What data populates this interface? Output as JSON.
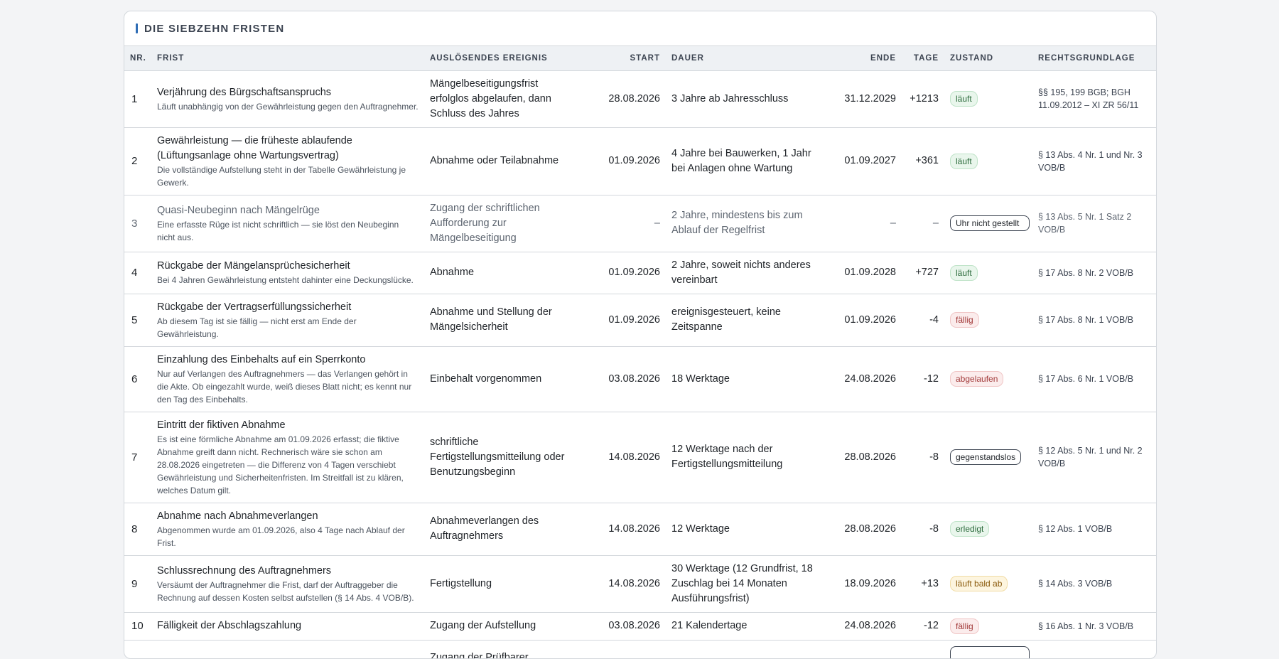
{
  "section": {
    "title": "DIE SIEBZEHN FRISTEN"
  },
  "columns": {
    "nr": "NR.",
    "frist": "FRIST",
    "ereignis": "AUSLÖSENDES EREIGNIS",
    "start": "START",
    "dauer": "DAUER",
    "ende": "ENDE",
    "tage": "TAGE",
    "zustand": "ZUSTAND",
    "rechtsgrundlage": "RECHTSGRUNDLAGE"
  },
  "colors": {
    "green": "#2c6b3c",
    "red": "#a23a3a",
    "yellow": "#8a5a0c",
    "accent": "#2f6db5"
  },
  "rows": [
    {
      "nr": "1",
      "title": "Verjährung des Bürgschaftsanspruchs",
      "sub": "Läuft unabhängig von der Gewährleistung gegen den Auftragnehmer.",
      "ereignis": "Mängelbeseitigungsfrist erfolglos abgelaufen, dann Schluss des Jahres",
      "start": "28.08.2026",
      "dauer": "3 Jahre ab Jahresschluss",
      "ende": "31.12.2029",
      "tage": "+1213",
      "zustand": "läuft",
      "zustand_style": "green",
      "law": "§§ 195, 199 BGB; BGH 11.09.2012 – XI ZR 56/11"
    },
    {
      "nr": "2",
      "title": "Gewährleistung — die früheste ablaufende (Lüftungsanlage ohne Wartungsvertrag)",
      "sub": "Die vollständige Aufstellung steht in der Tabelle Gewährleistung je Gewerk.",
      "ereignis": "Abnahme oder Teilabnahme",
      "start": "01.09.2026",
      "dauer": "4 Jahre bei Bauwerken, 1 Jahr bei Anlagen ohne Wartung",
      "ende": "01.09.2027",
      "tage": "+361",
      "zustand": "läuft",
      "zustand_style": "green",
      "law": "§ 13 Abs. 4 Nr. 1 und Nr. 3 VOB/B"
    },
    {
      "nr": "3",
      "title": "Quasi-Neubeginn nach Mängelrüge",
      "sub": "Eine erfasste Rüge ist nicht schriftlich — sie löst den Neubeginn nicht aus.",
      "ereignis": "Zugang der schriftlichen Aufforderung zur Mängelbeseitigung",
      "start": "–",
      "dauer": "2 Jahre, mindestens bis zum Ablauf der Regelfrist",
      "ende": "–",
      "tage": "–",
      "zustand": "Uhr nicht gestellt",
      "zustand_style": "outline-wrap",
      "law": "§ 13 Abs. 5 Nr. 1 Satz 2 VOB/B",
      "muted": true
    },
    {
      "nr": "4",
      "title": "Rückgabe der Mängelansprüchesicherheit",
      "sub": "Bei 4 Jahren Gewährleistung entsteht dahinter eine Deckungslücke.",
      "ereignis": "Abnahme",
      "start": "01.09.2026",
      "dauer": "2 Jahre, soweit nichts anderes vereinbart",
      "ende": "01.09.2028",
      "tage": "+727",
      "zustand": "läuft",
      "zustand_style": "green",
      "law": "§ 17 Abs. 8 Nr. 2 VOB/B"
    },
    {
      "nr": "5",
      "title": "Rückgabe der Vertragserfüllungssicherheit",
      "sub": "Ab diesem Tag ist sie fällig — nicht erst am Ende der Gewährleistung.",
      "ereignis": "Abnahme und Stellung der Mängelsicherheit",
      "start": "01.09.2026",
      "dauer": "ereignisgesteuert, keine Zeitspanne",
      "ende": "01.09.2026",
      "tage": "-4",
      "zustand": "fällig",
      "zustand_style": "red",
      "law": "§ 17 Abs. 8 Nr. 1 VOB/B"
    },
    {
      "nr": "6",
      "title": "Einzahlung des Einbehalts auf ein Sperrkonto",
      "sub": "Nur auf Verlangen des Auftragnehmers — das Verlangen gehört in die Akte. Ob eingezahlt wurde, weiß dieses Blatt nicht; es kennt nur den Tag des Einbehalts.",
      "ereignis": "Einbehalt vorgenommen",
      "start": "03.08.2026",
      "dauer": "18 Werktage",
      "ende": "24.08.2026",
      "tage": "-12",
      "zustand": "abgelaufen",
      "zustand_style": "red",
      "law": "§ 17 Abs. 6 Nr. 1 VOB/B"
    },
    {
      "nr": "7",
      "title": "Eintritt der fiktiven Abnahme",
      "sub": "Es ist eine förmliche Abnahme am 01.09.2026 erfasst; die fiktive Abnahme greift dann nicht. Rechnerisch wäre sie schon am 28.08.2026 eingetreten — die Differenz von 4 Tagen verschiebt Gewährleistung und Sicherheitenfristen. Im Streitfall ist zu klären, welches Datum gilt.",
      "ereignis": "schriftliche Fertigstellungsmitteilung oder Benutzungsbeginn",
      "start": "14.08.2026",
      "dauer": "12 Werktage nach der Fertigstellungsmitteilung",
      "ende": "28.08.2026",
      "tage": "-8",
      "zustand": "gegenstandslos",
      "zustand_style": "outline",
      "law": "§ 12 Abs. 5 Nr. 1 und Nr. 2 VOB/B"
    },
    {
      "nr": "8",
      "title": "Abnahme nach Abnahmeverlangen",
      "sub": "Abgenommen wurde am 01.09.2026, also 4 Tage nach Ablauf der Frist.",
      "ereignis": "Abnahmeverlangen des Auftragnehmers",
      "start": "14.08.2026",
      "dauer": "12 Werktage",
      "ende": "28.08.2026",
      "tage": "-8",
      "zustand": "erledigt",
      "zustand_style": "green",
      "law": "§ 12 Abs. 1 VOB/B"
    },
    {
      "nr": "9",
      "title": "Schlussrechnung des Auftragnehmers",
      "sub": "Versäumt der Auftragnehmer die Frist, darf der Auftraggeber die Rechnung auf dessen Kosten selbst aufstellen (§ 14 Abs. 4 VOB/B).",
      "ereignis": "Fertigstellung",
      "start": "14.08.2026",
      "dauer": "30 Werktage (12 Grundfrist, 18 Zuschlag bei 14 Monaten Ausführungsfrist)",
      "ende": "18.09.2026",
      "tage": "+13",
      "zustand": "läuft bald ab",
      "zustand_style": "yellow",
      "law": "§ 14 Abs. 3 VOB/B"
    },
    {
      "nr": "10",
      "title": "Fälligkeit der Abschlagszahlung",
      "sub": "",
      "ereignis": "Zugang der Aufstellung",
      "start": "03.08.2026",
      "dauer": "21 Kalendertage",
      "ende": "24.08.2026",
      "tage": "-12",
      "zustand": "fällig",
      "zustand_style": "red",
      "law": "§ 16 Abs. 1 Nr. 3 VOB/B"
    },
    {
      "nr": "",
      "title": "",
      "sub": "",
      "ereignis": "Zugang der Prüfbarer",
      "start": "",
      "dauer": "",
      "ende": "",
      "tage": "",
      "zustand": "",
      "zustand_style": "outline",
      "law": ""
    }
  ]
}
